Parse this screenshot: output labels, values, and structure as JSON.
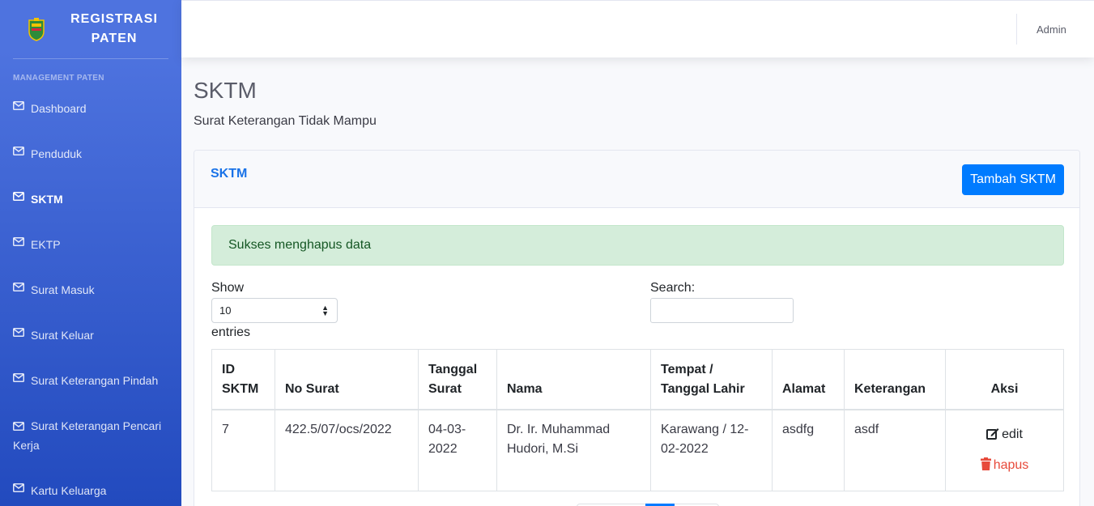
{
  "brand": {
    "title": "REGISTRASI PATEN"
  },
  "sidebar": {
    "heading": "MANAGEMENT PATEN",
    "items": [
      {
        "label": "Dashboard",
        "icon": "envelope-icon"
      },
      {
        "label": "Penduduk",
        "icon": "envelope-icon"
      },
      {
        "label": "SKTM",
        "icon": "envelope-icon",
        "active": true
      },
      {
        "label": "EKTP",
        "icon": "envelope-icon"
      },
      {
        "label": "Surat Masuk",
        "icon": "envelope-icon"
      },
      {
        "label": "Surat Keluar",
        "icon": "envelope-icon"
      },
      {
        "label": "Surat Keterangan Pindah",
        "icon": "envelope-icon"
      },
      {
        "label": "Surat Keterangan Pencari Kerja",
        "icon": "envelope-icon"
      },
      {
        "label": "Kartu Keluarga",
        "icon": "envelope-icon"
      }
    ]
  },
  "topbar": {
    "user": "Admin"
  },
  "page": {
    "title": "SKTM",
    "subtitle": "Surat Keterangan Tidak Mampu"
  },
  "card": {
    "title": "SKTM",
    "add_button": "Tambah SKTM",
    "alert": "Sukses menghapus data",
    "show_label": "Show",
    "entries_value": "10",
    "entries_label": "entries",
    "search_label": "Search:",
    "search_value": ""
  },
  "table": {
    "headers": [
      "ID SKTM",
      "No Surat",
      "Tanggal Surat",
      "Nama",
      "Tempat / Tanggal Lahir",
      "Alamat",
      "Keterangan",
      "Aksi"
    ],
    "rows": [
      {
        "id": "7",
        "no_surat": "422.5/07/ocs/2022",
        "tanggal": "04-03-2022",
        "nama": "Dr. Ir. Muhammad Hudori, M.Si",
        "ttl": "Karawang / 12-02-2022",
        "alamat": "asdfg",
        "keterangan": "asdf",
        "edit": "edit",
        "hapus": "hapus"
      }
    ]
  },
  "colors": {
    "sidebar_top": "#4e73df",
    "sidebar_bottom": "#224abe",
    "primary": "#007bff",
    "danger": "#e74a3b",
    "success_bg": "#d4edda"
  }
}
